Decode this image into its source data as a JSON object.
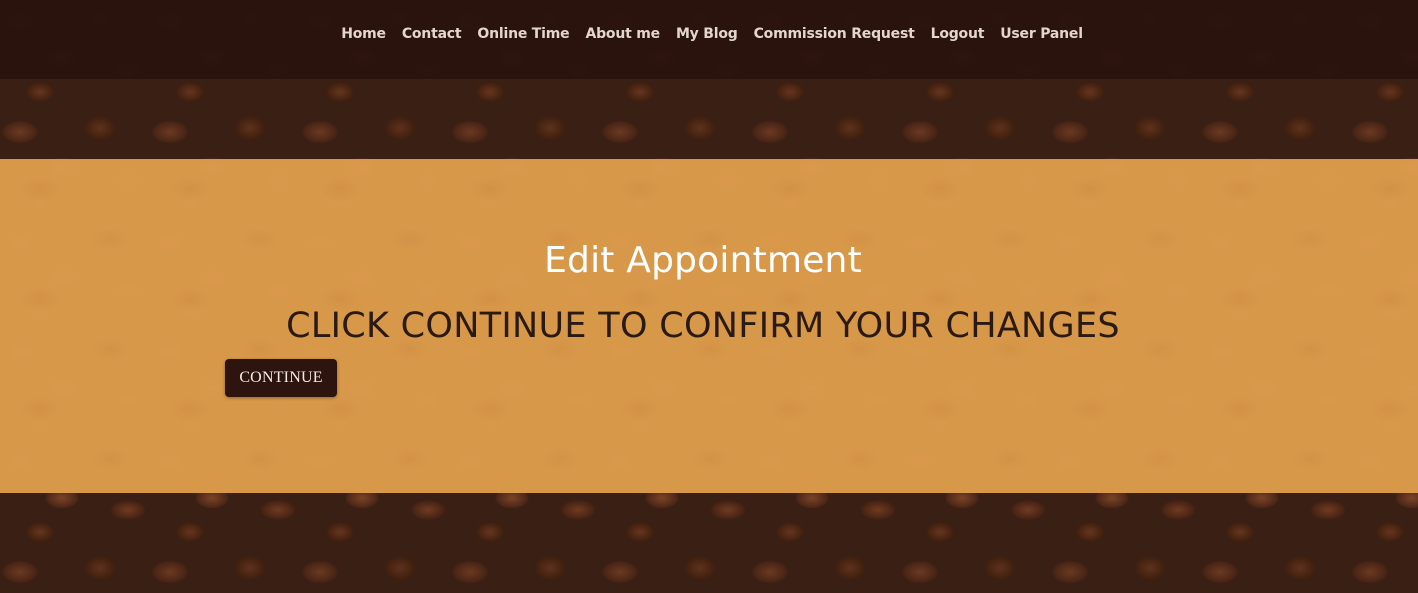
{
  "nav": {
    "items": [
      {
        "label": "Home"
      },
      {
        "label": "Contact"
      },
      {
        "label": "Online Time"
      },
      {
        "label": "About me"
      },
      {
        "label": "My Blog"
      },
      {
        "label": "Commission Request"
      },
      {
        "label": "Logout"
      },
      {
        "label": "User Panel"
      }
    ]
  },
  "main": {
    "title": "Edit Appointment",
    "message": "CLICK CONTINUE TO CONFIRM YOUR CHANGES",
    "continue_label": "CONTINUE"
  },
  "colors": {
    "topbar": "#28120c",
    "band": "#dd9c4c",
    "button": "#2e140e",
    "nav_text": "#e3d6cf"
  }
}
